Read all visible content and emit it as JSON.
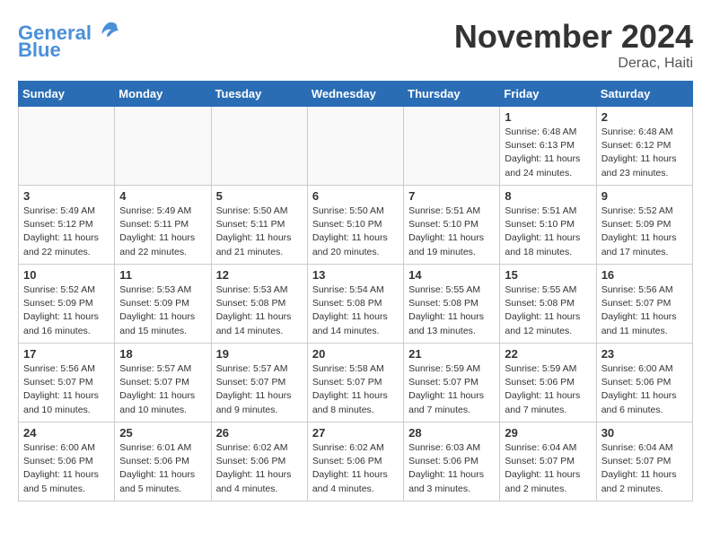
{
  "header": {
    "logo_line1": "General",
    "logo_line2": "Blue",
    "month_title": "November 2024",
    "location": "Derac, Haiti"
  },
  "days_of_week": [
    "Sunday",
    "Monday",
    "Tuesday",
    "Wednesday",
    "Thursday",
    "Friday",
    "Saturday"
  ],
  "weeks": [
    [
      {
        "day": "",
        "info": ""
      },
      {
        "day": "",
        "info": ""
      },
      {
        "day": "",
        "info": ""
      },
      {
        "day": "",
        "info": ""
      },
      {
        "day": "",
        "info": ""
      },
      {
        "day": "1",
        "info": "Sunrise: 6:48 AM\nSunset: 6:13 PM\nDaylight: 11 hours and 24 minutes."
      },
      {
        "day": "2",
        "info": "Sunrise: 6:48 AM\nSunset: 6:12 PM\nDaylight: 11 hours and 23 minutes."
      }
    ],
    [
      {
        "day": "3",
        "info": "Sunrise: 5:49 AM\nSunset: 5:12 PM\nDaylight: 11 hours and 22 minutes."
      },
      {
        "day": "4",
        "info": "Sunrise: 5:49 AM\nSunset: 5:11 PM\nDaylight: 11 hours and 22 minutes."
      },
      {
        "day": "5",
        "info": "Sunrise: 5:50 AM\nSunset: 5:11 PM\nDaylight: 11 hours and 21 minutes."
      },
      {
        "day": "6",
        "info": "Sunrise: 5:50 AM\nSunset: 5:10 PM\nDaylight: 11 hours and 20 minutes."
      },
      {
        "day": "7",
        "info": "Sunrise: 5:51 AM\nSunset: 5:10 PM\nDaylight: 11 hours and 19 minutes."
      },
      {
        "day": "8",
        "info": "Sunrise: 5:51 AM\nSunset: 5:10 PM\nDaylight: 11 hours and 18 minutes."
      },
      {
        "day": "9",
        "info": "Sunrise: 5:52 AM\nSunset: 5:09 PM\nDaylight: 11 hours and 17 minutes."
      }
    ],
    [
      {
        "day": "10",
        "info": "Sunrise: 5:52 AM\nSunset: 5:09 PM\nDaylight: 11 hours and 16 minutes."
      },
      {
        "day": "11",
        "info": "Sunrise: 5:53 AM\nSunset: 5:09 PM\nDaylight: 11 hours and 15 minutes."
      },
      {
        "day": "12",
        "info": "Sunrise: 5:53 AM\nSunset: 5:08 PM\nDaylight: 11 hours and 14 minutes."
      },
      {
        "day": "13",
        "info": "Sunrise: 5:54 AM\nSunset: 5:08 PM\nDaylight: 11 hours and 14 minutes."
      },
      {
        "day": "14",
        "info": "Sunrise: 5:55 AM\nSunset: 5:08 PM\nDaylight: 11 hours and 13 minutes."
      },
      {
        "day": "15",
        "info": "Sunrise: 5:55 AM\nSunset: 5:08 PM\nDaylight: 11 hours and 12 minutes."
      },
      {
        "day": "16",
        "info": "Sunrise: 5:56 AM\nSunset: 5:07 PM\nDaylight: 11 hours and 11 minutes."
      }
    ],
    [
      {
        "day": "17",
        "info": "Sunrise: 5:56 AM\nSunset: 5:07 PM\nDaylight: 11 hours and 10 minutes."
      },
      {
        "day": "18",
        "info": "Sunrise: 5:57 AM\nSunset: 5:07 PM\nDaylight: 11 hours and 10 minutes."
      },
      {
        "day": "19",
        "info": "Sunrise: 5:57 AM\nSunset: 5:07 PM\nDaylight: 11 hours and 9 minutes."
      },
      {
        "day": "20",
        "info": "Sunrise: 5:58 AM\nSunset: 5:07 PM\nDaylight: 11 hours and 8 minutes."
      },
      {
        "day": "21",
        "info": "Sunrise: 5:59 AM\nSunset: 5:07 PM\nDaylight: 11 hours and 7 minutes."
      },
      {
        "day": "22",
        "info": "Sunrise: 5:59 AM\nSunset: 5:06 PM\nDaylight: 11 hours and 7 minutes."
      },
      {
        "day": "23",
        "info": "Sunrise: 6:00 AM\nSunset: 5:06 PM\nDaylight: 11 hours and 6 minutes."
      }
    ],
    [
      {
        "day": "24",
        "info": "Sunrise: 6:00 AM\nSunset: 5:06 PM\nDaylight: 11 hours and 5 minutes."
      },
      {
        "day": "25",
        "info": "Sunrise: 6:01 AM\nSunset: 5:06 PM\nDaylight: 11 hours and 5 minutes."
      },
      {
        "day": "26",
        "info": "Sunrise: 6:02 AM\nSunset: 5:06 PM\nDaylight: 11 hours and 4 minutes."
      },
      {
        "day": "27",
        "info": "Sunrise: 6:02 AM\nSunset: 5:06 PM\nDaylight: 11 hours and 4 minutes."
      },
      {
        "day": "28",
        "info": "Sunrise: 6:03 AM\nSunset: 5:06 PM\nDaylight: 11 hours and 3 minutes."
      },
      {
        "day": "29",
        "info": "Sunrise: 6:04 AM\nSunset: 5:07 PM\nDaylight: 11 hours and 2 minutes."
      },
      {
        "day": "30",
        "info": "Sunrise: 6:04 AM\nSunset: 5:07 PM\nDaylight: 11 hours and 2 minutes."
      }
    ]
  ]
}
